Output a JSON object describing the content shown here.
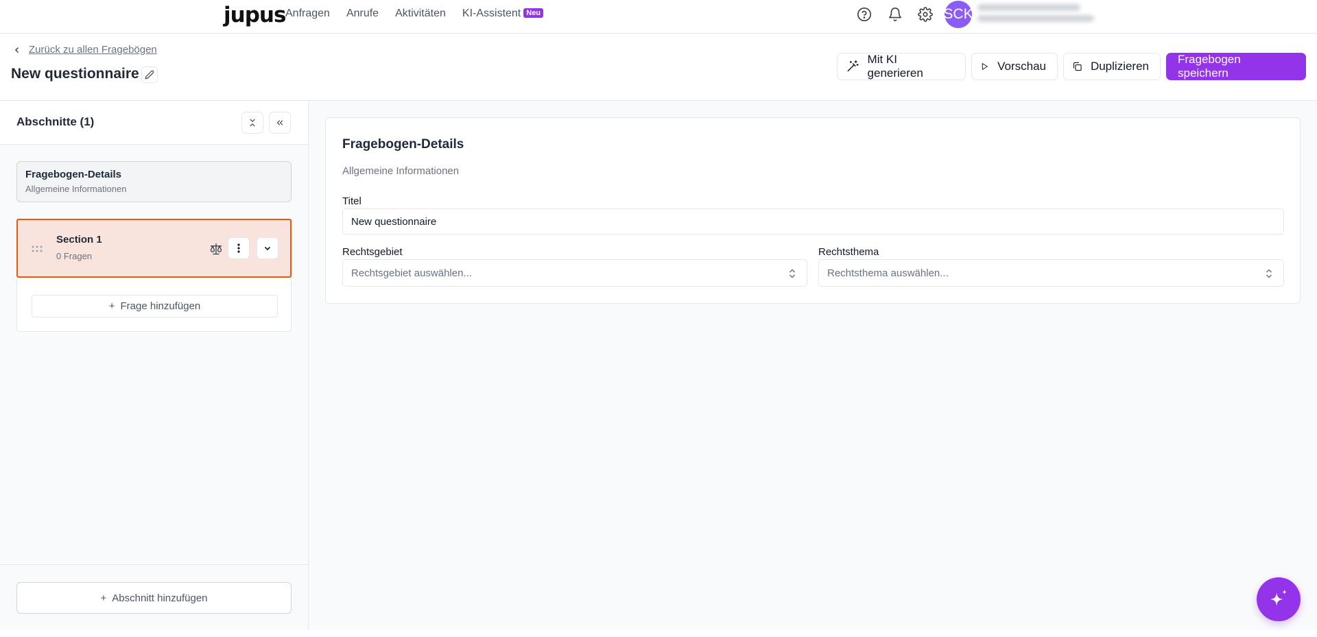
{
  "nav": {
    "logo": "jupus",
    "links": [
      "Anfragen",
      "Anrufe",
      "Aktivitäten",
      "KI-Assistent"
    ],
    "new_badge": "Neu",
    "avatar_initials": "SCK",
    "icons": [
      "help-circle-icon",
      "bell-icon",
      "gear-icon"
    ]
  },
  "header": {
    "back_label": "Zurück zu allen Fragebögen",
    "title": "New questionnaire",
    "buttons": {
      "ai_generate": "Mit KI generieren",
      "preview": "Vorschau",
      "duplicate": "Duplizieren",
      "save": "Fragebogen speichern"
    }
  },
  "sidebar": {
    "title": "Abschnitte (1)",
    "details_card": {
      "title": "Fragebogen-Details",
      "subtitle": "Allgemeine Informationen"
    },
    "sections": [
      {
        "title": "Section 1",
        "subtitle": "0 Fragen"
      }
    ],
    "add_question": "Frage hinzufügen",
    "add_section": "Abschnitt hinzufügen"
  },
  "main": {
    "panel_title": "Fragebogen-Details",
    "panel_subtitle": "Allgemeine Informationen",
    "title_label": "Titel",
    "title_value": "New questionnaire",
    "area_label": "Rechtsgebiet",
    "area_placeholder": "Rechtsgebiet auswählen...",
    "topic_label": "Rechtsthema",
    "topic_placeholder": "Rechtsthema auswählen..."
  },
  "colors": {
    "accent": "#9333ea",
    "avatar": "#8b5cf6",
    "selected_border": "#ea580c",
    "selected_bg": "#f9e3dd"
  }
}
